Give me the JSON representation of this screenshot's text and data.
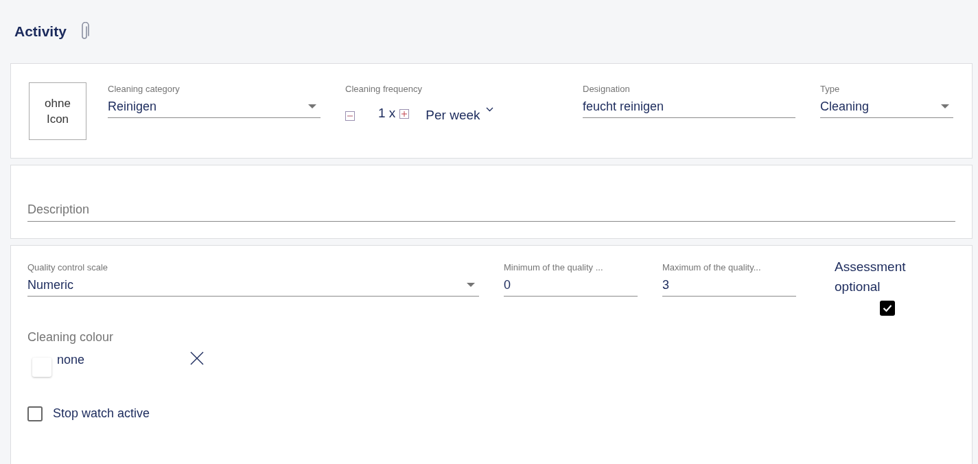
{
  "header": {
    "title": "Activity"
  },
  "main": {
    "icon_placeholder": "ohne Icon",
    "category": {
      "label": "Cleaning category",
      "value": "Reinigen"
    },
    "frequency": {
      "label": "Cleaning frequency",
      "count": "1 x",
      "period": "Per week"
    },
    "designation": {
      "label": "Designation",
      "value": "feucht reinigen"
    },
    "type": {
      "label": "Type",
      "value": "Cleaning"
    }
  },
  "description": {
    "placeholder": "Description"
  },
  "quality": {
    "scale": {
      "label": "Quality control scale",
      "value": "Numeric"
    },
    "minimum": {
      "label": "Minimum of the quality ...",
      "value": "0"
    },
    "maximum": {
      "label": "Maximum of the quality...",
      "value": "3"
    },
    "assessment": {
      "label": "Assessment optional",
      "checked": true
    }
  },
  "colour": {
    "label": "Cleaning colour",
    "value": "none",
    "color": "#ffffff"
  },
  "stop_watch": {
    "label": "Stop watch active",
    "checked": false
  }
}
